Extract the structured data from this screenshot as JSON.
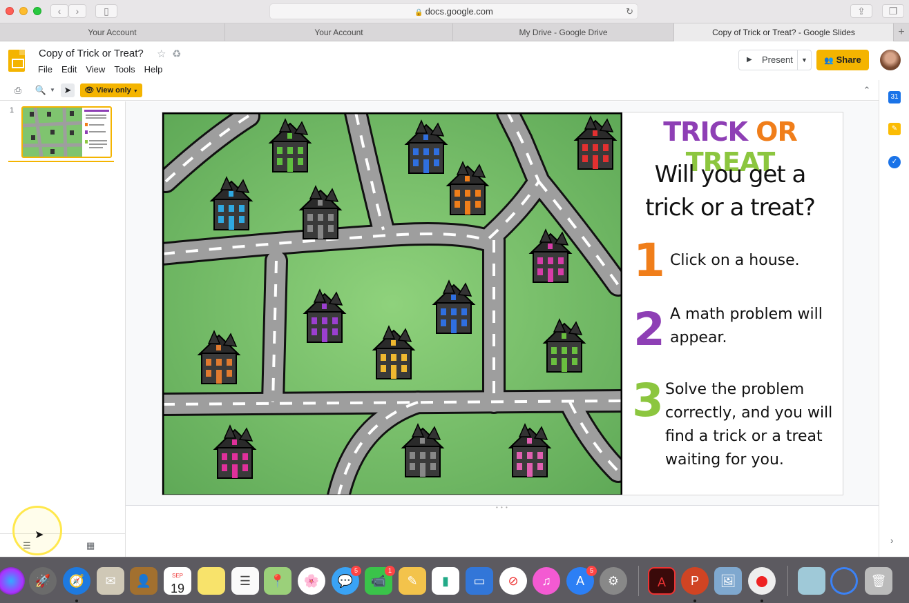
{
  "browser": {
    "url": "docs.google.com",
    "tabs": [
      {
        "label": "Your Account"
      },
      {
        "label": "Your Account"
      },
      {
        "label": "My Drive - Google Drive"
      },
      {
        "label": "Copy of Trick or Treat? - Google Slides"
      }
    ],
    "new_tab": "+"
  },
  "app": {
    "doc_title": "Copy of Trick or Treat?",
    "menu": [
      "File",
      "Edit",
      "View",
      "Tools",
      "Help"
    ],
    "present_label": "Present",
    "share_label": "Share",
    "view_only_label": "View only"
  },
  "filmstrip": {
    "slide_number": "1"
  },
  "slide": {
    "title_words": [
      "TRICK",
      "OR",
      "TREAT"
    ],
    "question_line1": "Will you get a",
    "question_line2": "trick or a treat?",
    "steps": [
      {
        "num": "1",
        "line1": "Click on a house.",
        "line2": "",
        "line3": "",
        "line4": "",
        "color": "#f07e1a"
      },
      {
        "num": "2",
        "line1": "A math problem will",
        "line2": "appear.",
        "line3": "",
        "line4": "",
        "color": "#8e3fb5"
      },
      {
        "num": "3",
        "line1": "Solve the problem",
        "line2": "correctly, and you will",
        "line3": "find a trick or a treat",
        "line4": "waiting for you.",
        "color": "#8cc63f"
      }
    ]
  },
  "dock": {
    "calendar_month": "SEP",
    "calendar_day": "19",
    "badges": {
      "messages": "5",
      "facetime": "1",
      "appstore": "5"
    }
  },
  "colors": {
    "accent": "#f4b400",
    "grass": "#7fc46f",
    "road": "#9e9e9e"
  }
}
